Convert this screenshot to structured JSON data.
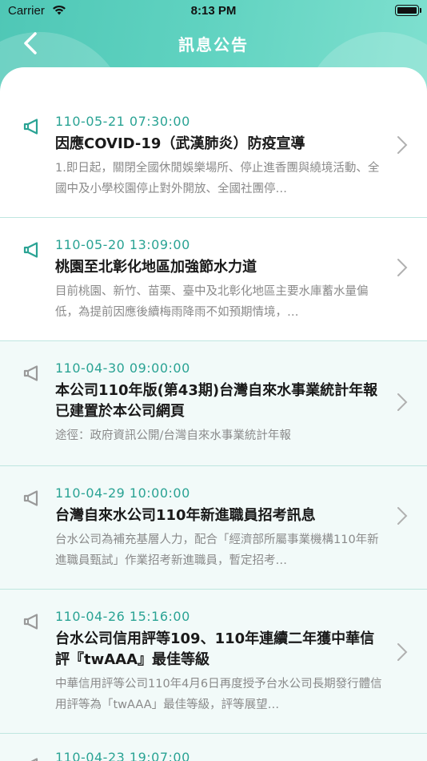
{
  "status_bar": {
    "carrier": "Carrier",
    "time": "8:13 PM"
  },
  "nav": {
    "title": "訊息公告",
    "back_icon": "chevron-left-icon"
  },
  "colors": {
    "accent": "#2aa394",
    "header": "#5fd2c0",
    "icon_active": "#2aa394",
    "icon_inactive": "#999999"
  },
  "items": [
    {
      "date": "110-05-21 07:30:00",
      "title": "因應COVID-19（武漢肺炎）防疫宣導",
      "body": "1.即日起，關閉全國休閒娛樂場所、停止進香團與繞境活動、全國中及小學校園停止對外開放、全國社團停…",
      "unread": true
    },
    {
      "date": "110-05-20 13:09:00",
      "title": "桃園至北彰化地區加強節水力道",
      "body": "目前桃園、新竹、苗栗、臺中及北彰化地區主要水庫蓄水量偏低，為提前因應後續梅雨降雨不如預期情境，…",
      "unread": true
    },
    {
      "date": "110-04-30 09:00:00",
      "title": "本公司110年版(第43期)台灣自來水事業統計年報已建置於本公司網頁",
      "body": "途徑：政府資訊公開/台灣自來水事業統計年報",
      "unread": false
    },
    {
      "date": "110-04-29 10:00:00",
      "title": "台灣自來水公司110年新進職員招考訊息",
      "body": "台水公司為補充基層人力，配合「經濟部所屬事業機構110年新進職員甄試」作業招考新進職員，暫定招考…",
      "unread": false
    },
    {
      "date": "110-04-26 15:16:00",
      "title": "台水公司信用評等109、110年連續二年獲中華信評『twAAA』最佳等級",
      "body": "中華信用評等公司110年4月6日再度授予台水公司長期發行體信用評等為「twAAA」最佳等級，評等展望…",
      "unread": false
    },
    {
      "date": "110-04-23 19:07:00",
      "title": "",
      "body": "",
      "unread": false
    }
  ]
}
